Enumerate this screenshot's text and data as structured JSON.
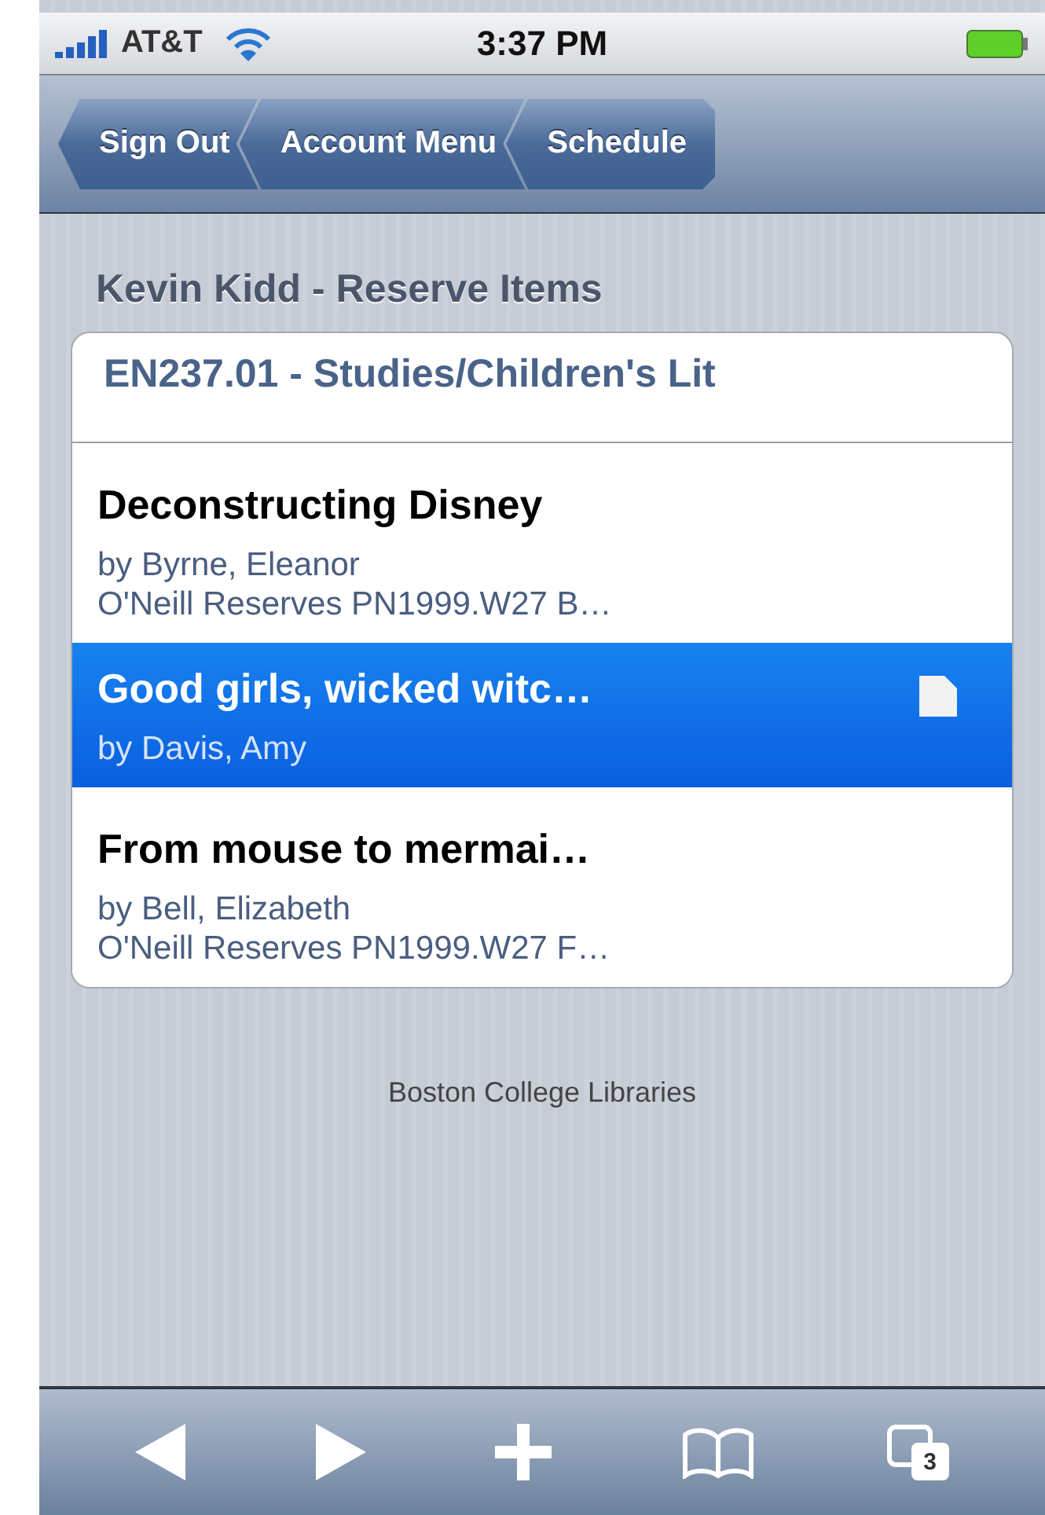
{
  "status_bar": {
    "carrier": "AT&T",
    "time": "3:37 PM"
  },
  "breadcrumbs": [
    {
      "label": "Sign Out"
    },
    {
      "label": "Account Menu"
    },
    {
      "label": "Schedule"
    }
  ],
  "page_title": "Kevin Kidd - Reserve Items",
  "course": "EN237.01 - Studies/Children's Lit",
  "items": [
    {
      "title": "Deconstructing Disney",
      "author": "by Byrne, Eleanor",
      "location": "O'Neill Reserves PN1999.W27 B…",
      "selected": false,
      "document": false
    },
    {
      "title": "Good girls, wicked witc…",
      "author": "by Davis, Amy",
      "selected": true,
      "document": true
    },
    {
      "title": "From mouse to mermai…",
      "author": "by Bell, Elizabeth",
      "location": "O'Neill Reserves PN1999.W27 F…",
      "selected": false,
      "document": false
    }
  ],
  "footer": "Boston College Libraries",
  "toolbar": {
    "tabs_count": "3"
  }
}
